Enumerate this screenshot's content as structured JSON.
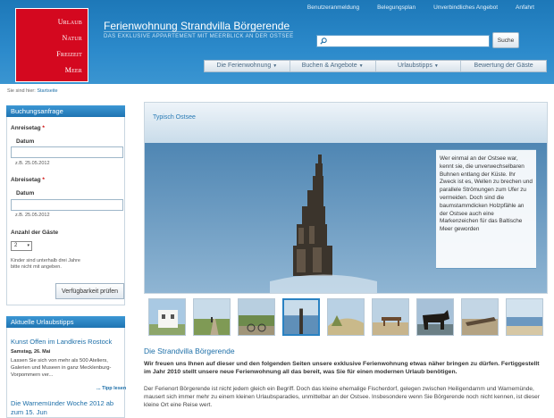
{
  "header": {
    "logo_words": [
      "Urlaub",
      "Natur",
      "Freizeit",
      "Meer"
    ],
    "title": "Ferienwohnung Strandvilla Börgerende",
    "subtitle": "DAS EXKLUSIVE APPARTEMENT MIT MEERBLICK AN DER OSTSEE",
    "top_links": [
      "Benutzeranmeldung",
      "Belegungsplan",
      "Unverbindliches Angebot",
      "Anfahrt"
    ],
    "search": {
      "placeholder": "",
      "button_label": "Suche"
    }
  },
  "nav": [
    {
      "label": "Die Ferienwohnung",
      "caret": "▼"
    },
    {
      "label": "Buchen & Angebote",
      "caret": "▼"
    },
    {
      "label": "Urlaubstipps",
      "caret": "▼"
    },
    {
      "label": "Bewertung der Gäste",
      "caret": ""
    }
  ],
  "breadcrumb": {
    "prefix": "Sie sind hier:",
    "current": "Startseite"
  },
  "booking": {
    "title": "Buchungsanfrage",
    "arrival_label": "Anreisetag",
    "departure_label": "Abreisetag",
    "date_label": "Datum",
    "required_mark": "*",
    "arrival_hint": "z.B. 25.05.2012",
    "departure_hint": "z.B. 25.05.2012",
    "guests_label": "Anzahl der Gäste",
    "guests_value": "2",
    "guests_note_1": "Kinder sind unterhalb drei Jahre",
    "guests_note_2": "bitte nicht mit angeben.",
    "submit_label": "Verfügbarkeit prüfen"
  },
  "tips": {
    "title": "Aktuelle Urlaubstipps",
    "items": [
      {
        "title": "Kunst Offen im Landkreis Rostock",
        "date": "Samstag, 26. Mai",
        "text_1": "Lassen Sie sich von mehr als 500 Ateliers,",
        "text_2": "Galerien und Museen in ganz Mecklenburg-",
        "text_3": "Vorpommern ver...",
        "more": "... Tipp lesen"
      },
      {
        "title_1": "Die Warnemünder Woche 2012 ab",
        "title_2": "zum 15. Jun"
      }
    ]
  },
  "slider": {
    "caption": "Typisch Ostsee",
    "text": "Wer einmal an der Ostsee war, kennt sie, die unverwechselbaren Buhnen entlang der Küste. Ihr Zweck ist es, Wellen zu brechen und parallele Strömungen zum Ufer zu vermeiden. Doch sind die baumstammdicken Holzpfähle an der Ostsee auch eine Markenzeichen für das Baltische Meer geworden",
    "colors": {
      "sky": "#c9dcea",
      "sea": "#6f9cc1"
    }
  },
  "thumbnails": [
    "house-thumbnail",
    "path-thumbnail",
    "bikes-thumbnail",
    "groyne-thumbnail",
    "dune-thumbnail",
    "bench-thumbnail",
    "horses-thumbnail",
    "driftwood-thumbnail",
    "beach-thumbnail"
  ],
  "main": {
    "section_title": "Die Strandvilla Börgerende",
    "intro_bold": "Wir freuen uns Ihnen auf dieser und den folgenden Seiten unsere exklusive Ferienwohnung etwas näher bringen zu dürfen. Fertiggestellt im Jahr 2010 stellt unsere neue Ferienwohnung all das bereit, was Sie für einen modernen Urlaub benötigen.",
    "intro": "Der Ferienort Börgerende ist nicht jedem gleich ein Begriff. Doch das kleine ehemalige Fischerdorf, gelegen zwischen Heiligendamm und Warnemünde, mausert sich immer mehr zu einem kleinen Urlaubsparadies, unmittelbar an der Ostsee. Insbesondere wenn Sie Börgerende noch nicht kennen, ist dieser kleine Ort eine Reise wert."
  }
}
